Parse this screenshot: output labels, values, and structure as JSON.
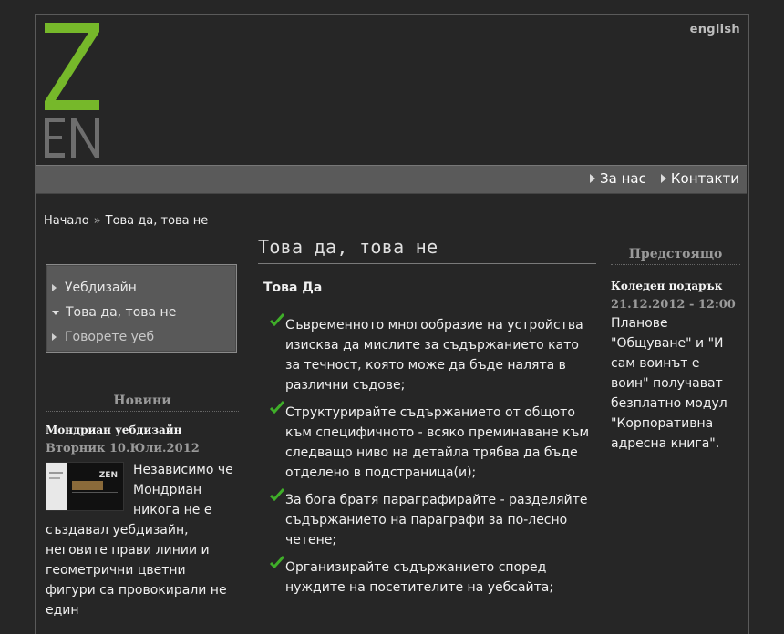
{
  "header": {
    "logo_letters": "ZEN",
    "lang_link": "english"
  },
  "nav": {
    "items": [
      {
        "label": "За нас"
      },
      {
        "label": "Контакти"
      }
    ]
  },
  "breadcrumb": {
    "home": "Начало",
    "separator": "»",
    "current": "Това да, това не"
  },
  "submenu": {
    "items": [
      {
        "label": "Уебдизайн"
      },
      {
        "label": "Това да, това не"
      },
      {
        "label": "Говорете уеб"
      }
    ]
  },
  "news": {
    "heading": "Новини",
    "item": {
      "title": "Мондриан уебдизайн",
      "date": "Вторник 10.Юли.2012",
      "thumb_label": "ZEN",
      "body": "Независимо че Мондриан никога не е създавал уебдизайн, неговите прави линии и геометрични цветни фигури са провокирали не един"
    }
  },
  "main": {
    "title": "Това да, това не",
    "subheading": "Това Да",
    "list": [
      "Съвременното многообразие на устройства изисква да мислите за съдържанието като за течност, която може да бъде налята в различни съдове;",
      "Структурирайте съдържанието от общото към специфичното - всяко преминаване към следващо ниво на детайла трябва да бъде отделено в подстраница(и);",
      "За бога братя параграфирайте - разделяйте съдържанието на параграфи за по-лесно четене;",
      "Организирайте съдържанието според нуждите на посетителите на уебсайта;"
    ]
  },
  "upcoming": {
    "heading": "Предстоящо",
    "item": {
      "title": "Коледен подарък",
      "date": "21.12.2012 - 12:00",
      "body": "Планове \"Общуване\" и \"И сам воинът е воин\" получават безплатно модул \"Корпоративна адресна книга\"."
    }
  },
  "colors": {
    "background": "#262626",
    "logo_green": "#76b82a",
    "logo_gray": "#6e6e6e",
    "navbar": "#5a5a5a",
    "check_green": "#3fae29"
  }
}
